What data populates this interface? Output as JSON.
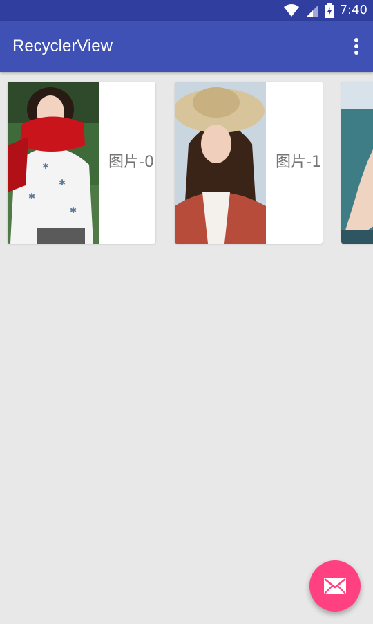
{
  "status_bar": {
    "time": "7:40",
    "icons": [
      "wifi-icon",
      "cell-signal-icon",
      "battery-charging-icon"
    ]
  },
  "app_bar": {
    "title": "RecyclerView",
    "overflow_icon": "more-vert-icon"
  },
  "list": {
    "items": [
      {
        "caption": "图片-0"
      },
      {
        "caption": "图片-1"
      },
      {
        "caption": ""
      }
    ]
  },
  "fab": {
    "icon": "mail-icon",
    "color": "#ff4081"
  },
  "colors": {
    "primary": "#3f51b5",
    "primary_dark": "#303f9f",
    "accent": "#ff4081",
    "background": "#e8e8e8"
  }
}
